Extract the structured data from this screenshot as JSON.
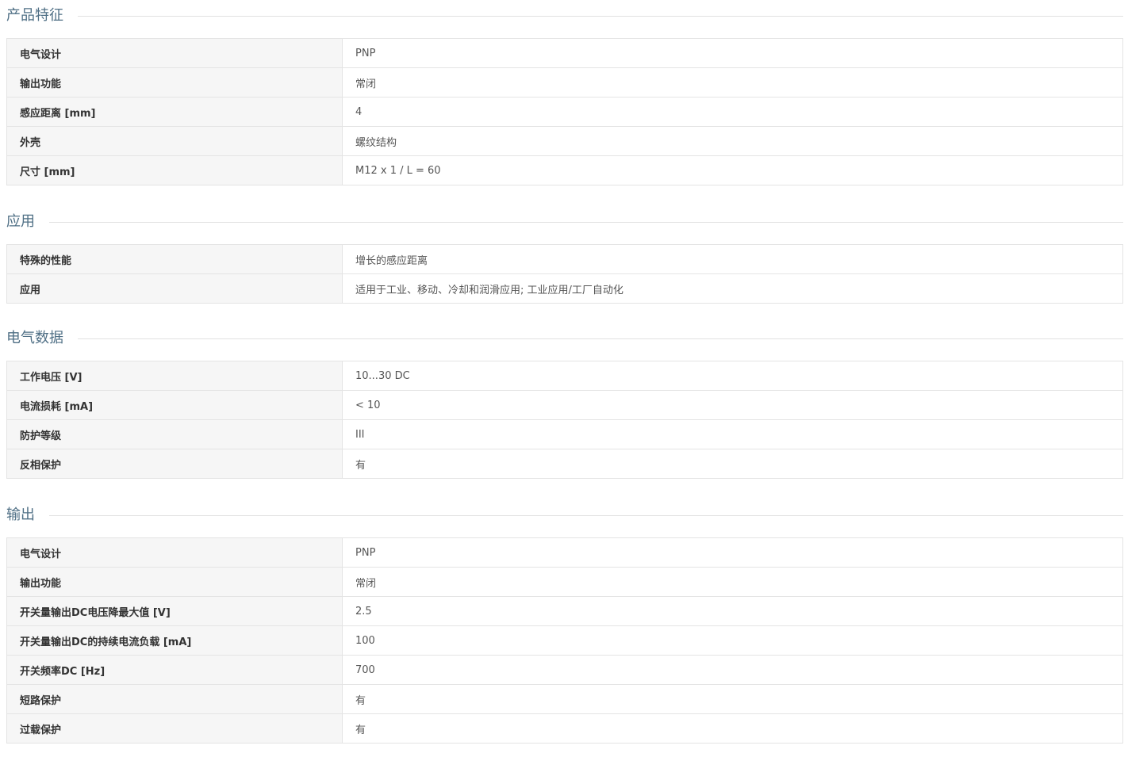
{
  "sections": [
    {
      "title": "产品特征",
      "rows": [
        {
          "label": "电气设计",
          "value": "PNP"
        },
        {
          "label": "输出功能",
          "value": "常闭"
        },
        {
          "label": "感应距离 [mm]",
          "value": "4"
        },
        {
          "label": "外壳",
          "value": "螺纹结构"
        },
        {
          "label": "尺寸 [mm]",
          "value": "M12 x 1 / L = 60"
        }
      ]
    },
    {
      "title": "应用",
      "rows": [
        {
          "label": "特殊的性能",
          "value": "增长的感应距离"
        },
        {
          "label": "应用",
          "value": "适用于工业、移动、冷却和润滑应用; 工业应用/工厂自动化"
        }
      ]
    },
    {
      "title": "电气数据",
      "rows": [
        {
          "label": "工作电压 [V]",
          "value": "10...30 DC"
        },
        {
          "label": "电流损耗 [mA]",
          "value": "< 10"
        },
        {
          "label": "防护等级",
          "value": "III"
        },
        {
          "label": "反相保护",
          "value": "有"
        }
      ]
    },
    {
      "title": "输出",
      "rows": [
        {
          "label": "电气设计",
          "value": "PNP"
        },
        {
          "label": "输出功能",
          "value": "常闭"
        },
        {
          "label": "开关量输出DC电压降最大值 [V]",
          "value": "2.5"
        },
        {
          "label": "开关量输出DC的持续电流负载 [mA]",
          "value": "100"
        },
        {
          "label": "开关频率DC [Hz]",
          "value": "700"
        },
        {
          "label": "短路保护",
          "value": "有"
        },
        {
          "label": "过载保护",
          "value": "有"
        }
      ]
    }
  ]
}
